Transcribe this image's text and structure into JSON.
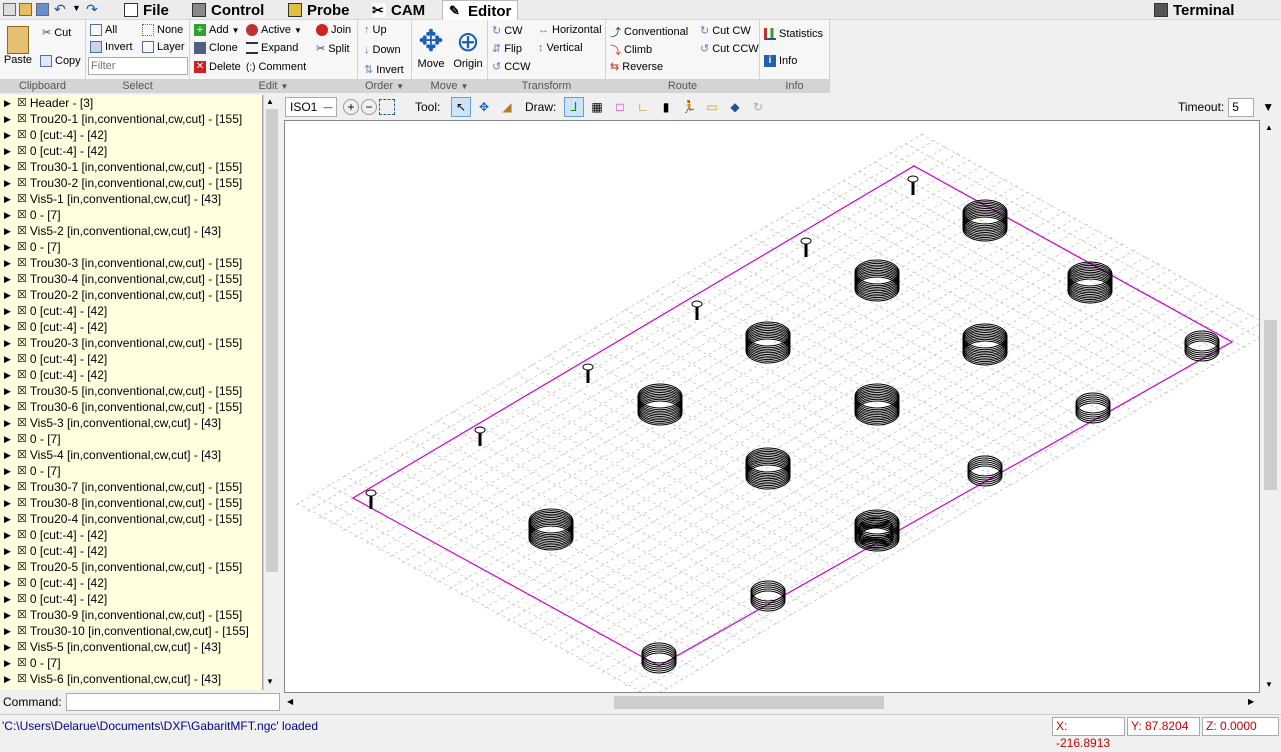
{
  "menu": {
    "tabs": [
      {
        "label": "File",
        "icon": "file-icon"
      },
      {
        "label": "Control",
        "icon": "control-icon"
      },
      {
        "label": "Probe",
        "icon": "probe-icon"
      },
      {
        "label": "CAM",
        "icon": "cam-icon"
      },
      {
        "label": "Editor",
        "icon": "editor-icon"
      }
    ],
    "terminal": "Terminal"
  },
  "ribbon": {
    "clipboard": {
      "label": "Clipboard",
      "paste": "Paste",
      "cut": "Cut",
      "copy": "Copy"
    },
    "select": {
      "label": "Select",
      "all": "All",
      "none": "None",
      "invert": "Invert",
      "layer": "Layer",
      "filter_placeholder": "Filter"
    },
    "edit": {
      "label": "Edit",
      "add": "Add",
      "active": "Active",
      "join": "Join",
      "clone": "Clone",
      "expand": "Expand",
      "split": "Split",
      "delete": "Delete",
      "comment": "Comment"
    },
    "order": {
      "label": "Order",
      "up": "Up",
      "down": "Down",
      "invert": "Invert"
    },
    "move": {
      "label": "Move",
      "move": "Move",
      "origin": "Origin"
    },
    "transform": {
      "label": "Transform",
      "cw": "CW",
      "horizontal": "Horizontal",
      "flip": "Flip",
      "vertical": "Vertical",
      "ccw": "CCW"
    },
    "route": {
      "label": "Route",
      "conventional": "Conventional",
      "climb": "Climb",
      "reverse": "Reverse",
      "cut_cw": "Cut CW",
      "cut_ccw": "Cut CCW"
    },
    "info": {
      "label": "Info",
      "statistics": "Statistics",
      "info": "Info"
    }
  },
  "tree": [
    "Header - [3]",
    "Trou20-1 [in,conventional,cw,cut] - [155]",
    "0 [cut:-4] - [42]",
    "0 [cut:-4] - [42]",
    "Trou30-1 [in,conventional,cw,cut] - [155]",
    "Trou30-2 [in,conventional,cw,cut] - [155]",
    "Vis5-1 [in,conventional,cw,cut] - [43]",
    "0 - [7]",
    "Vis5-2 [in,conventional,cw,cut] - [43]",
    "0 - [7]",
    "Trou30-3 [in,conventional,cw,cut] - [155]",
    "Trou30-4 [in,conventional,cw,cut] - [155]",
    "Trou20-2 [in,conventional,cw,cut] - [155]",
    "0 [cut:-4] - [42]",
    "0 [cut:-4] - [42]",
    "Trou20-3 [in,conventional,cw,cut] - [155]",
    "0 [cut:-4] - [42]",
    "0 [cut:-4] - [42]",
    "Trou30-5 [in,conventional,cw,cut] - [155]",
    "Trou30-6 [in,conventional,cw,cut] - [155]",
    "Vis5-3 [in,conventional,cw,cut] - [43]",
    "0 - [7]",
    "Vis5-4 [in,conventional,cw,cut] - [43]",
    "0 - [7]",
    "Trou30-7 [in,conventional,cw,cut] - [155]",
    "Trou30-8 [in,conventional,cw,cut] - [155]",
    "Trou20-4 [in,conventional,cw,cut] - [155]",
    "0 [cut:-4] - [42]",
    "0 [cut:-4] - [42]",
    "Trou20-5 [in,conventional,cw,cut] - [155]",
    "0 [cut:-4] - [42]",
    "0 [cut:-4] - [42]",
    "Trou30-9 [in,conventional,cw,cut] - [155]",
    "Trou30-10 [in,conventional,cw,cut] - [155]",
    "Vis5-5 [in,conventional,cw,cut] - [43]",
    "0 - [7]",
    "Vis5-6 [in,conventional,cw,cut] - [43]"
  ],
  "command": {
    "label": "Command:",
    "value": ""
  },
  "canvas_toolbar": {
    "view": "ISO1",
    "tool_label": "Tool:",
    "draw_label": "Draw:",
    "timeout_label": "Timeout:",
    "timeout_value": "5"
  },
  "status": {
    "message": "'C:\\Users\\Delarue\\Documents\\DXF\\GabaritMFT.ngc' loaded",
    "x": "X: -216.8913",
    "y": "Y: 87.8204",
    "z": "Z: 0.0000"
  },
  "colors": {
    "accent": "#cc00cc",
    "tree_bg": "#ffffe0",
    "status_text": "#00008b",
    "coord_text": "#cc0000"
  }
}
